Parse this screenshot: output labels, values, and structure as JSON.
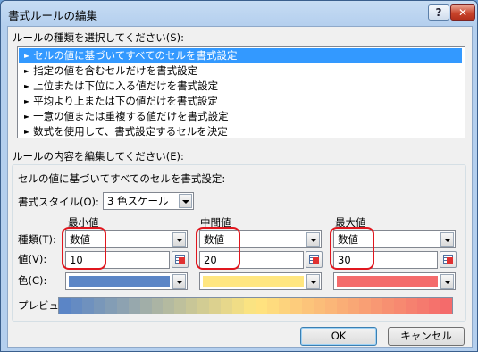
{
  "window": {
    "title": "書式ルールの編集",
    "help_glyph": "?",
    "close_glyph": "✕"
  },
  "rule_type": {
    "label": "ルールの種類を選択してください(S):",
    "arrow_glyph": "►",
    "items": [
      "セルの値に基づいてすべてのセルを書式設定",
      "指定の値を含むセルだけを書式設定",
      "上位または下位に入る値だけを書式設定",
      "平均より上または下の値だけを書式設定",
      "一意の値または重複する値だけを書式設定",
      "数式を使用して、書式設定するセルを決定"
    ],
    "selected_index": 0
  },
  "rule_content": {
    "label": "ルールの内容を編集してください(E):",
    "description": "セルの値に基づいてすべてのセルを書式設定:",
    "style_label": "書式スタイル(O):",
    "style_value": "3 色スケール",
    "row_labels": {
      "type": "種類(T):",
      "value": "値(V):",
      "color": "色(C):"
    },
    "columns": [
      {
        "header": "最小値",
        "type": "数値",
        "value": "10",
        "color": "#5b85c6"
      },
      {
        "header": "中間値",
        "type": "数値",
        "value": "20",
        "color": "#ffe680"
      },
      {
        "header": "最大値",
        "type": "数値",
        "value": "30",
        "color": "#f46b6b"
      }
    ],
    "preview_label": "プレビュー:"
  },
  "buttons": {
    "ok": "OK",
    "cancel": "キャンセル"
  },
  "accent_colors": {
    "selection": "#3399ff",
    "highlight": "#e0161e"
  }
}
